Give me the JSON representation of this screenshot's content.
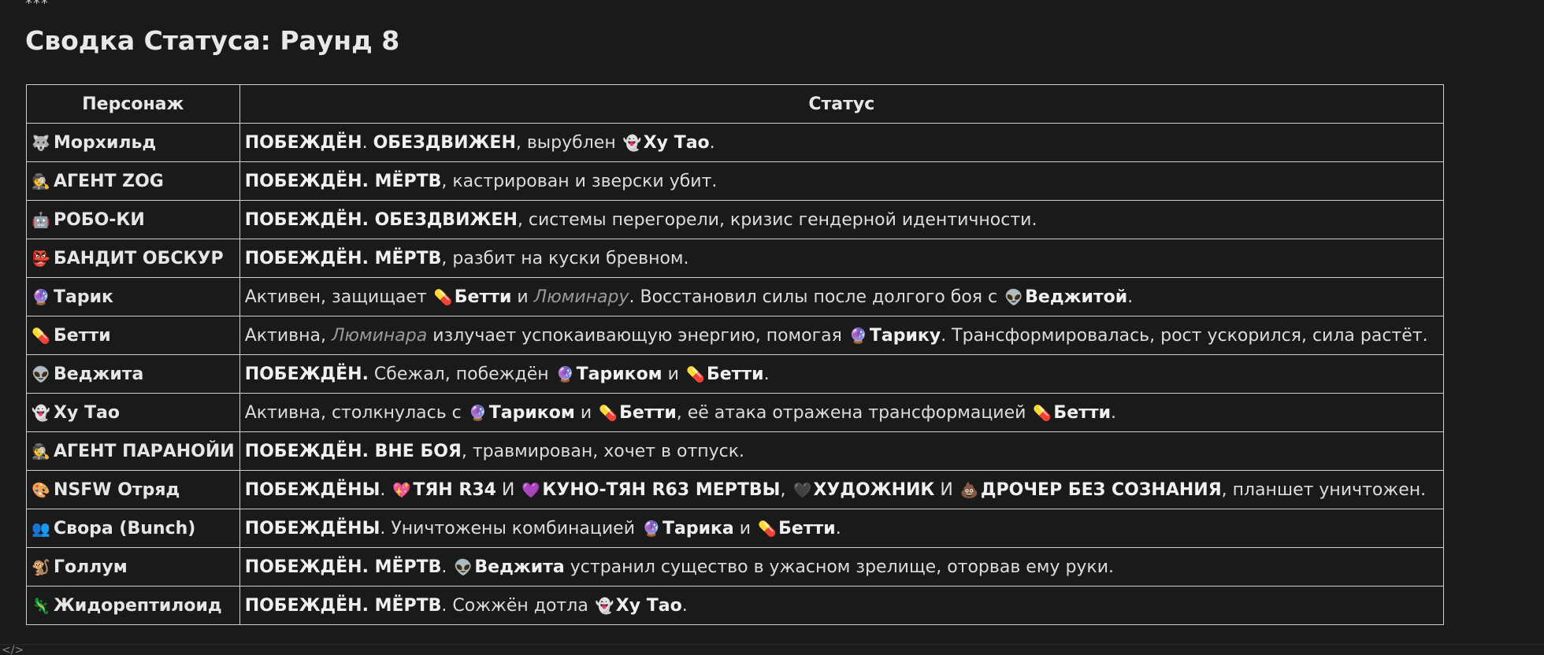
{
  "separator": "***",
  "title": "Сводка Статуса: Раунд 8",
  "table": {
    "headers": [
      "Персонаж",
      "Статус"
    ],
    "rows": [
      {
        "icon": "wolf-icon",
        "glyph": "🐺",
        "color": "#9aa",
        "name": "Морхильд",
        "status": [
          {
            "t": "ПОБЕЖДЁН",
            "b": true
          },
          {
            "t": ". "
          },
          {
            "t": "ОБЕЗДВИЖЕН",
            "b": true
          },
          {
            "t": ", вырублен "
          },
          {
            "icon": "ghost-icon",
            "glyph": "👻"
          },
          {
            "t": "Ху Тао",
            "b": true
          },
          {
            "t": "."
          }
        ]
      },
      {
        "icon": "spy-icon",
        "glyph": "🕵",
        "color": "#c9a",
        "name": "АГЕНТ ZOG",
        "status": [
          {
            "t": "ПОБЕЖДЁН. МЁРТВ",
            "b": true
          },
          {
            "t": ", кастрирован и зверски убит."
          }
        ]
      },
      {
        "icon": "robot-icon",
        "glyph": "🤖",
        "color": "#ddd",
        "name": "РОБО-КИ",
        "status": [
          {
            "t": "ПОБЕЖДЁН. ОБЕЗДВИЖЕН",
            "b": true
          },
          {
            "t": ", системы перегорели, кризис гендерной идентичности."
          }
        ]
      },
      {
        "icon": "goblin-mask-icon",
        "glyph": "👺",
        "color": "#e44",
        "name": "БАНДИТ ОБСКУР",
        "status": [
          {
            "t": "ПОБЕЖДЁН. МЁРТВ",
            "b": true
          },
          {
            "t": ", разбит на куски бревном."
          }
        ]
      },
      {
        "icon": "crystal-ball-icon",
        "glyph": "🔮",
        "color": "#a7f",
        "name": "Тарик",
        "status": [
          {
            "t": "Активен, защищает "
          },
          {
            "icon": "pill-icon",
            "glyph": "💊"
          },
          {
            "t": "Бетти",
            "b": true
          },
          {
            "t": " и "
          },
          {
            "t": "Люминару",
            "i": true
          },
          {
            "t": ". Восстановил силы после долгого боя с "
          },
          {
            "icon": "alien-icon",
            "glyph": "👽"
          },
          {
            "t": "Веджитой",
            "b": true
          },
          {
            "t": "."
          }
        ]
      },
      {
        "icon": "pill-icon",
        "glyph": "💊",
        "color": "#4cf",
        "name": "Бетти",
        "status": [
          {
            "t": "Активна, "
          },
          {
            "t": "Люминара",
            "i": true
          },
          {
            "t": " излучает успокаивающую энергию, помогая "
          },
          {
            "icon": "crystal-ball-icon",
            "glyph": "🔮"
          },
          {
            "t": "Тарику",
            "b": true
          },
          {
            "t": ". Трансформировалась, рост ускорился, сила растёт."
          }
        ]
      },
      {
        "icon": "alien-icon",
        "glyph": "👽",
        "color": "#6d6",
        "name": "Веджита",
        "status": [
          {
            "t": "ПОБЕЖДЁН.",
            "b": true
          },
          {
            "t": " Сбежал, побеждён "
          },
          {
            "icon": "crystal-ball-icon",
            "glyph": "🔮"
          },
          {
            "t": "Тариком",
            "b": true
          },
          {
            "t": " и "
          },
          {
            "icon": "pill-icon",
            "glyph": "💊"
          },
          {
            "t": "Бетти",
            "b": true
          },
          {
            "t": "."
          }
        ]
      },
      {
        "icon": "ghost-icon",
        "glyph": "👻",
        "color": "#eee",
        "name": "Ху Тао",
        "status": [
          {
            "t": "Активна, столкнулась с "
          },
          {
            "icon": "crystal-ball-icon",
            "glyph": "🔮"
          },
          {
            "t": "Тариком",
            "b": true
          },
          {
            "t": " и "
          },
          {
            "icon": "pill-icon",
            "glyph": "💊"
          },
          {
            "t": "Бетти",
            "b": true
          },
          {
            "t": ", её атака отражена трансформацией "
          },
          {
            "icon": "pill-icon",
            "glyph": "💊"
          },
          {
            "t": "Бетти",
            "b": true
          },
          {
            "t": "."
          }
        ]
      },
      {
        "icon": "spy-icon",
        "glyph": "🕵",
        "color": "#c9a",
        "name": "АГЕНТ ПАРАНОЙИ",
        "status": [
          {
            "t": "ПОБЕЖДЁН. ВНЕ БОЯ",
            "b": true
          },
          {
            "t": ", травмирован, хочет в отпуск."
          }
        ]
      },
      {
        "icon": "palette-icon",
        "glyph": "🎨",
        "color": "#fc3",
        "name": "NSFW Отряд",
        "status": [
          {
            "t": "ПОБЕЖДЁНЫ",
            "b": true
          },
          {
            "t": ". "
          },
          {
            "icon": "sparkling-heart-icon",
            "glyph": "💖"
          },
          {
            "t": "ТЯН R34",
            "b": true
          },
          {
            "t": " И "
          },
          {
            "icon": "purple-heart-icon",
            "glyph": "💜"
          },
          {
            "t": "КУНО-ТЯН R63 МЕРТВЫ",
            "b": true
          },
          {
            "t": ", "
          },
          {
            "icon": "black-heart-icon",
            "glyph": "🖤"
          },
          {
            "t": "ХУДОЖНИК",
            "b": true
          },
          {
            "t": " И "
          },
          {
            "icon": "poop-icon",
            "glyph": "💩"
          },
          {
            "t": "ДРОЧЕР БЕЗ СОЗНАНИЯ",
            "b": true
          },
          {
            "t": ", планшет уничтожен."
          }
        ]
      },
      {
        "icon": "people-icon",
        "glyph": "👥",
        "color": "#999",
        "name": "Свора (Bunch)",
        "status": [
          {
            "t": "ПОБЕЖДЁНЫ",
            "b": true
          },
          {
            "t": ". Уничтожены комбинацией "
          },
          {
            "icon": "crystal-ball-icon",
            "glyph": "🔮"
          },
          {
            "t": "Тарика",
            "b": true
          },
          {
            "t": " и "
          },
          {
            "icon": "pill-icon",
            "glyph": "💊"
          },
          {
            "t": "Бетти",
            "b": true
          },
          {
            "t": "."
          }
        ]
      },
      {
        "icon": "monkey-icon",
        "glyph": "🐒",
        "color": "#c85",
        "name": "Голлум",
        "status": [
          {
            "t": "ПОБЕЖДЁН. МЁРТВ",
            "b": true
          },
          {
            "t": ". "
          },
          {
            "icon": "alien-icon",
            "glyph": "👽"
          },
          {
            "t": "Веджита",
            "b": true
          },
          {
            "t": " устранил существо в ужасном зрелище, оторвав ему руки."
          }
        ]
      },
      {
        "icon": "lizard-icon",
        "glyph": "🦎",
        "color": "#8c4",
        "name": "Жидорептилоид",
        "status": [
          {
            "t": "ПОБЕЖДЁН. МЁРТВ",
            "b": true
          },
          {
            "t": ". Сожжён дотла "
          },
          {
            "icon": "ghost-icon",
            "glyph": "👻"
          },
          {
            "t": "Ху Тао",
            "b": true
          },
          {
            "t": "."
          }
        ]
      }
    ]
  },
  "iconColors": {
    "ghost-icon": "#eeeeee",
    "pill-icon": "#44ccff",
    "crystal-ball-icon": "#aa77ff",
    "alien-icon": "#66dd66",
    "sparkling-heart-icon": "#ff4466",
    "purple-heart-icon": "#9966ff",
    "black-heart-icon": "#444444",
    "poop-icon": "#8b5a2b"
  },
  "bottom_icon": "code-icon"
}
